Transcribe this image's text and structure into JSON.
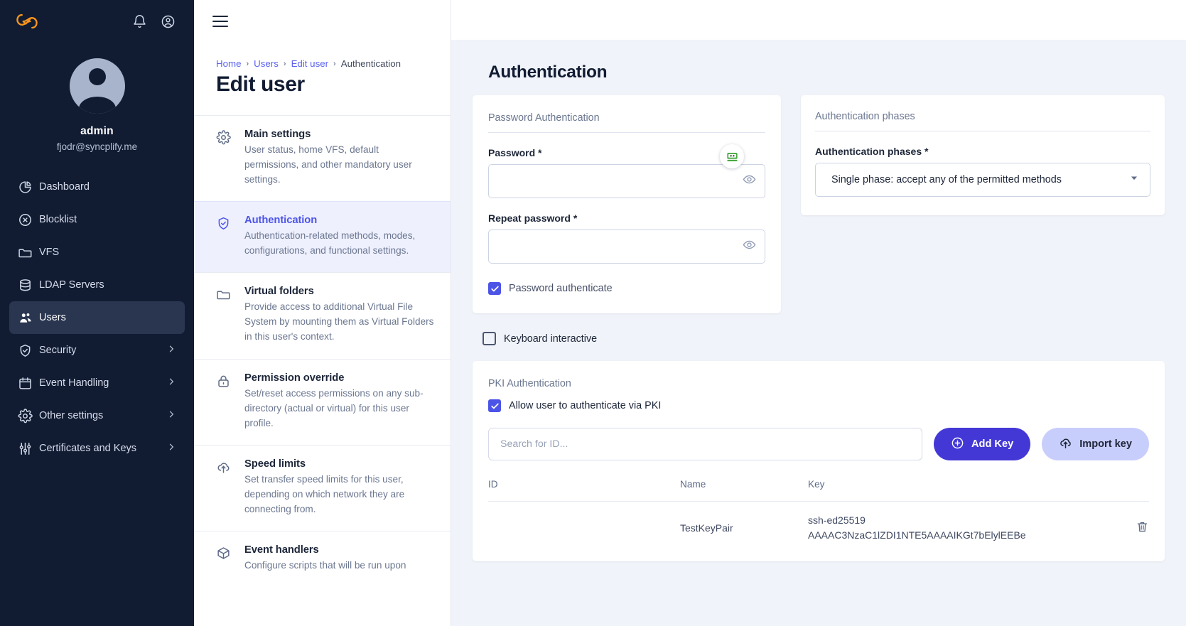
{
  "brand": {
    "logo_icon": "syncplify-cloud-logo"
  },
  "topbar": {
    "bell_icon": "bell-icon",
    "account_icon": "user-circle-icon",
    "menu_icon": "hamburger-menu-icon"
  },
  "user": {
    "name": "admin",
    "email": "fjodr@syncplify.me",
    "avatar_icon": "user-avatar-icon"
  },
  "sidebar": {
    "items": [
      {
        "label": "Dashboard",
        "icon": "pie-chart-icon",
        "active": false,
        "chevron": false
      },
      {
        "label": "Blocklist",
        "icon": "x-circle-icon",
        "active": false,
        "chevron": false
      },
      {
        "label": "VFS",
        "icon": "folder-icon",
        "active": false,
        "chevron": false
      },
      {
        "label": "LDAP Servers",
        "icon": "database-icon",
        "active": false,
        "chevron": false
      },
      {
        "label": "Users",
        "icon": "users-icon",
        "active": true,
        "chevron": false
      },
      {
        "label": "Security",
        "icon": "shield-check-icon",
        "active": false,
        "chevron": true
      },
      {
        "label": "Event Handling",
        "icon": "calendar-icon",
        "active": false,
        "chevron": true
      },
      {
        "label": "Other settings",
        "icon": "gear-icon",
        "active": false,
        "chevron": true
      },
      {
        "label": "Certificates and Keys",
        "icon": "sliders-icon",
        "active": false,
        "chevron": true
      }
    ]
  },
  "panel": {
    "breadcrumb": [
      {
        "label": "Home",
        "link": true
      },
      {
        "label": "Users",
        "link": true
      },
      {
        "label": "Edit user",
        "link": true
      },
      {
        "label": "Authentication",
        "link": false
      }
    ],
    "separator": "›",
    "title": "Edit user",
    "items": [
      {
        "name": "Main settings",
        "icon": "gear-icon",
        "selected": false,
        "desc": "User status, home VFS, default permissions, and other mandatory user settings."
      },
      {
        "name": "Authentication",
        "icon": "shield-check-icon",
        "selected": true,
        "desc": "Authentication-related methods, modes, configurations, and functional settings."
      },
      {
        "name": "Virtual folders",
        "icon": "folder-icon",
        "selected": false,
        "desc": "Provide access to additional Virtual File System by mounting them as Virtual Folders in this user's context."
      },
      {
        "name": "Permission override",
        "icon": "lock-icon",
        "selected": false,
        "desc": "Set/reset access permissions on any sub-directory (actual or virtual) for this user profile."
      },
      {
        "name": "Speed limits",
        "icon": "cloud-upload-icon",
        "selected": false,
        "desc": "Set transfer speed limits for this user, depending on which network they are connecting from."
      },
      {
        "name": "Event handlers",
        "icon": "box-icon",
        "selected": false,
        "desc": "Configure scripts that will be run upon"
      }
    ]
  },
  "main": {
    "heading": "Authentication",
    "password_card": {
      "section_label": "Password Authentication",
      "password": {
        "label": "Password *",
        "value": "",
        "placeholder": ""
      },
      "repeat": {
        "label": "Repeat password *",
        "value": "",
        "placeholder": ""
      },
      "eye_icon": "eye-icon",
      "password_manager_icon": "roboform-password-manager-icon",
      "checkbox": {
        "label": "Password authenticate",
        "checked": true
      }
    },
    "phases_card": {
      "section_label": "Authentication phases",
      "field_label": "Authentication phases *",
      "selected_option": "Single phase: accept any of the permitted methods",
      "caret_icon": "chevron-down-icon"
    },
    "keyboard_interactive": {
      "label": "Keyboard interactive",
      "checked": false
    },
    "pki_card": {
      "section_label": "PKI Authentication",
      "allow_checkbox": {
        "label": "Allow user to authenticate via PKI",
        "checked": true
      },
      "search_placeholder": "Search for ID...",
      "search_value": "",
      "add_key_button": {
        "label": "Add Key",
        "icon": "plus-circle-icon"
      },
      "import_key_button": {
        "label": "Import key",
        "icon": "cloud-upload-icon"
      },
      "table": {
        "columns": [
          "ID",
          "Name",
          "Key"
        ],
        "rows": [
          {
            "id": "",
            "name": "TestKeyPair",
            "key_line1": "ssh-ed25519",
            "key_line2": "AAAAC3NzaC1lZDI1NTE5AAAAIKGt7bElylEEBe",
            "delete_icon": "trash-icon"
          }
        ]
      }
    }
  },
  "colors": {
    "sidebar_bg": "#111c33",
    "accent": "#4c54e8",
    "primary_button": "#4338d6",
    "soft_button": "#c8cefb",
    "selected_row": "#eef0fe",
    "main_bg": "#f0f3f9"
  }
}
